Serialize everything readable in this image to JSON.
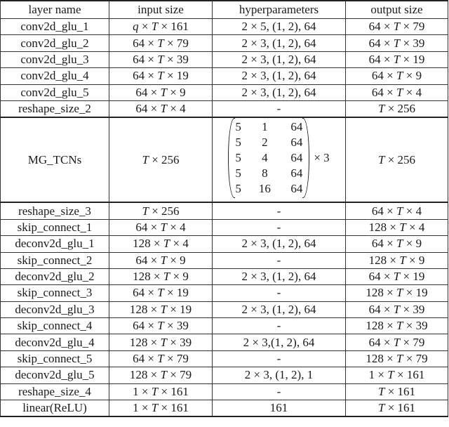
{
  "table": {
    "headers": [
      "layer name",
      "input size",
      "hyperparameters",
      "output size"
    ],
    "rows_before_tcn": [
      {
        "layer": "conv2d_glu_1",
        "input": "q × T × 161",
        "hyper": "2 × 5, (1, 2), 64",
        "output": "64 × T × 79"
      },
      {
        "layer": "conv2d_glu_2",
        "input": "64 × T × 79",
        "hyper": "2 × 3, (1, 2), 64",
        "output": "64 × T × 39"
      },
      {
        "layer": "conv2d_glu_3",
        "input": "64 × T × 39",
        "hyper": "2 × 3, (1, 2), 64",
        "output": "64 × T × 19"
      },
      {
        "layer": "conv2d_glu_4",
        "input": "64 × T × 19",
        "hyper": "2 × 3, (1, 2), 64",
        "output": "64 × T × 9"
      },
      {
        "layer": "conv2d_glu_5",
        "input": "64 × T × 9",
        "hyper": "2 × 3, (1, 2), 64",
        "output": "64 × T × 4"
      },
      {
        "layer": "reshape_size_2",
        "input": "64 × T × 4",
        "hyper": "-",
        "output": "T × 256"
      }
    ],
    "tcn_row": {
      "layer": "MG_TCNs",
      "input": "T × 256",
      "matrix": [
        [
          "5",
          "1",
          "64"
        ],
        [
          "5",
          "2",
          "64"
        ],
        [
          "5",
          "4",
          "64"
        ],
        [
          "5",
          "8",
          "64"
        ],
        [
          "5",
          "16",
          "64"
        ]
      ],
      "repeat": "× 3",
      "output": "T × 256"
    },
    "rows_after_tcn": [
      {
        "layer": "reshape_size_3",
        "input": "T × 256",
        "hyper": "-",
        "output": "64 × T × 4"
      },
      {
        "layer": "skip_connect_1",
        "input": "64 × T × 4",
        "hyper": "-",
        "output": "128 × T × 4"
      },
      {
        "layer": "deconv2d_glu_1",
        "input": "128 × T × 4",
        "hyper": "2 × 3, (1, 2), 64",
        "output": "64 × T × 9"
      },
      {
        "layer": "skip_connect_2",
        "input": "64 × T × 9",
        "hyper": "-",
        "output": "128 × T × 9"
      },
      {
        "layer": "deconv2d_glu_2",
        "input": "128 × T × 9",
        "hyper": "2 × 3, (1, 2), 64",
        "output": "64 × T × 19"
      },
      {
        "layer": "skip_connect_3",
        "input": "64 × T × 19",
        "hyper": "-",
        "output": "128 × T × 19"
      },
      {
        "layer": "deconv2d_glu_3",
        "input": "128 × T × 19",
        "hyper": "2 × 3, (1, 2), 64",
        "output": "64 × T × 39"
      },
      {
        "layer": "skip_connect_4",
        "input": "64 × T × 39",
        "hyper": "-",
        "output": "128 × T × 39"
      },
      {
        "layer": "deconv2d_glu_4",
        "input": "128 × T × 39",
        "hyper": "2 × 3,(1, 2), 64",
        "output": "64 × T × 79"
      },
      {
        "layer": "skip_connect_5",
        "input": "64 × T × 79",
        "hyper": "-",
        "output": "128 × T × 79"
      },
      {
        "layer": "deconv2d_glu_5",
        "input": "128 × T × 79",
        "hyper": "2 × 3, (1, 2), 1",
        "output": "1 × T × 161"
      },
      {
        "layer": "reshape_size_4",
        "input": "1 × T × 161",
        "hyper": "-",
        "output": "T × 161"
      },
      {
        "layer": "linear(ReLU)",
        "input": "1 × T × 161",
        "hyper": "161",
        "output": "T × 161"
      }
    ]
  }
}
